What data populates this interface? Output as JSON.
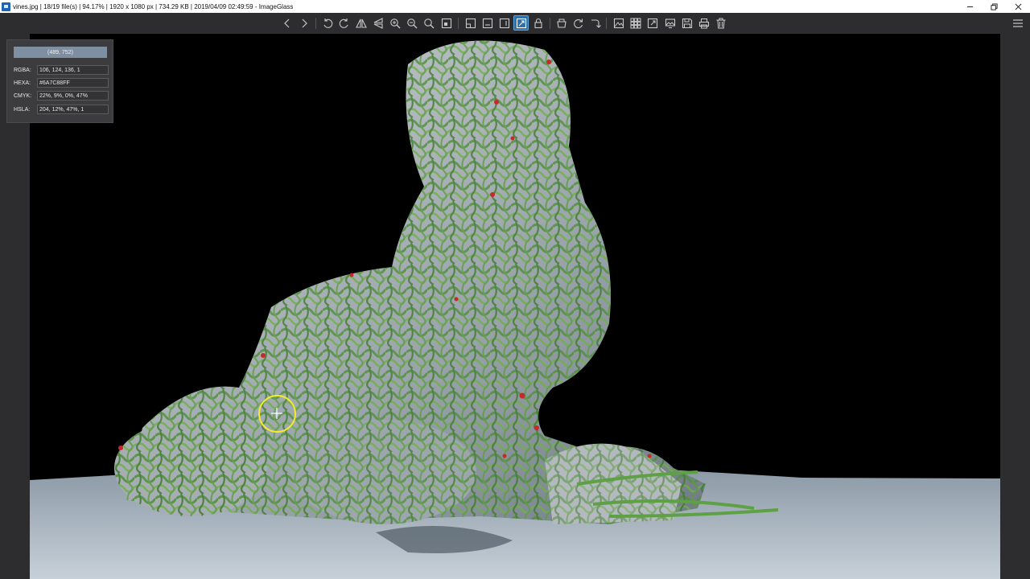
{
  "window": {
    "title": "vines.jpg  |  18/19 file(s)  |  94.17%  |  1920 x 1080 px  |  734.29 KB  |  2019/04/09 02:49:59  - ImageGlass",
    "controls": [
      "minimize-icon",
      "restore-icon",
      "close-icon"
    ]
  },
  "toolbar": {
    "buttons": [
      {
        "name": "previous-image",
        "icon": "chevron-left-icon"
      },
      {
        "name": "next-image",
        "icon": "chevron-right-icon"
      },
      {
        "name": "rotate-left",
        "icon": "rotate-left-icon"
      },
      {
        "name": "rotate-right",
        "icon": "rotate-right-icon"
      },
      {
        "name": "flip-horizontal",
        "icon": "flip-horizontal-icon"
      },
      {
        "name": "flip-vertical",
        "icon": "flip-vertical-icon"
      },
      {
        "name": "zoom-in",
        "icon": "zoom-in-icon"
      },
      {
        "name": "zoom-out",
        "icon": "zoom-out-icon"
      },
      {
        "name": "scale-to-fit",
        "icon": "zoom-fit-icon"
      },
      {
        "name": "actual-size",
        "icon": "actual-size-icon"
      },
      {
        "name": "auto-zoom",
        "icon": "auto-zoom-icon"
      },
      {
        "name": "scale-to-width",
        "icon": "scale-width-icon"
      },
      {
        "name": "scale-to-height",
        "icon": "scale-height-icon"
      },
      {
        "name": "scale-to-fill",
        "icon": "scale-fill-icon",
        "active": true
      },
      {
        "name": "lock-zoom",
        "icon": "lock-icon"
      },
      {
        "name": "open-file",
        "icon": "open-icon"
      },
      {
        "name": "refresh",
        "icon": "refresh-icon"
      },
      {
        "name": "goto-image",
        "icon": "goto-icon"
      },
      {
        "name": "slideshow",
        "icon": "image-icon"
      },
      {
        "name": "thumbnails",
        "icon": "thumbnail-grid-icon"
      },
      {
        "name": "fullscreen",
        "icon": "fullscreen-icon"
      },
      {
        "name": "set-wallpaper",
        "icon": "wallpaper-icon"
      },
      {
        "name": "save",
        "icon": "save-icon"
      },
      {
        "name": "print",
        "icon": "print-icon"
      },
      {
        "name": "delete",
        "icon": "trash-icon"
      }
    ],
    "menu_icon": "hamburger-menu-icon"
  },
  "color_picker": {
    "coordinates": "(489, 752)",
    "rows": [
      {
        "label": "RGBA:",
        "value": "106, 124, 136, 1"
      },
      {
        "label": "HEXA:",
        "value": "#6A7C88FF"
      },
      {
        "label": "CMYK:",
        "value": "22%, 9%, 0%, 47%"
      },
      {
        "label": "HSLA:",
        "value": "204, 12%, 47%, 1"
      }
    ]
  },
  "colors": {
    "accent": "#2e6fa8",
    "cursor": "#f2ec2a",
    "background": "#2d2d30"
  }
}
